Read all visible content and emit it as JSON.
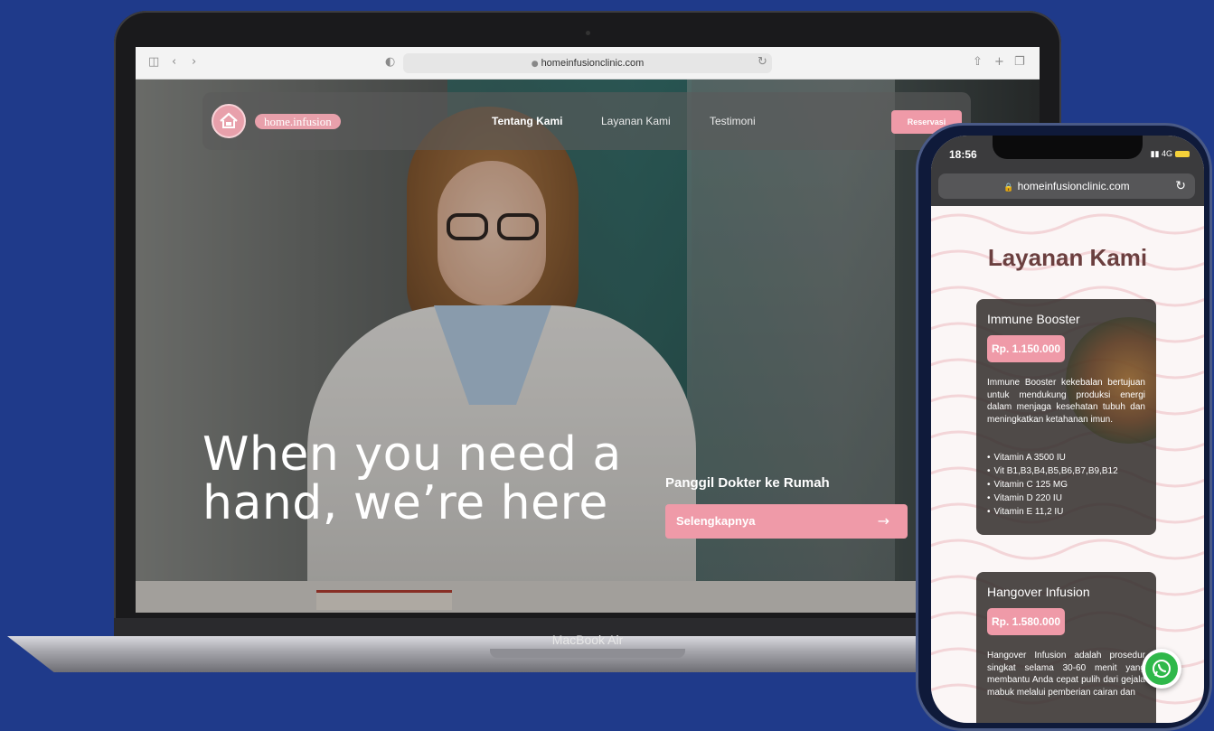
{
  "laptop": {
    "brand_label": "MacBook Air",
    "browser": {
      "url": "homeinfusionclinic.com",
      "icons": [
        "sidebar-icon",
        "back-icon",
        "forward-icon",
        "shield-icon",
        "reload-icon",
        "share-icon",
        "new-tab-icon",
        "tabs-icon"
      ]
    },
    "site": {
      "logo_text": "home.infusion",
      "nav": [
        {
          "label": "Tentang Kami",
          "active": true
        },
        {
          "label": "Layanan Kami",
          "active": false
        },
        {
          "label": "Testimoni",
          "active": false
        }
      ],
      "reservation_label": "Reservasi",
      "headline": "When you need a hand, we’re here",
      "cta_heading": "Panggil Dokter ke Rumah",
      "cta_button": "Selengkapnya"
    }
  },
  "phone": {
    "time": "18:56",
    "network": "4G",
    "url": "homeinfusionclinic.com",
    "section_title": "Layanan Kami",
    "services": [
      {
        "name": "Immune Booster",
        "price": "Rp. 1.150.000",
        "description": "Immune Booster kekebalan bertujuan untuk mendukung produksi energi dalam menjaga kesehatan tubuh dan meningkatkan ketahanan imun.",
        "items": [
          "Vitamin A 3500 IU",
          "Vit B1,B3,B4,B5,B6,B7,B9,B12",
          "Vitamin C 125 MG",
          "Vitamin D 220 IU",
          "Vitamin E 11,2 IU"
        ]
      },
      {
        "name": "Hangover Infusion",
        "price": "Rp. 1.580.000",
        "description": "Hangover Infusion adalah prosedur singkat selama 30-60 menit yang membantu Anda cepat pulih dari gejala mabuk melalui pemberian cairan dan"
      }
    ]
  },
  "colors": {
    "background": "#1f3a8a",
    "accent_pink": "#ef9aa8",
    "title_brown": "#6b3f3f",
    "whatsapp_green": "#2fb84a"
  }
}
